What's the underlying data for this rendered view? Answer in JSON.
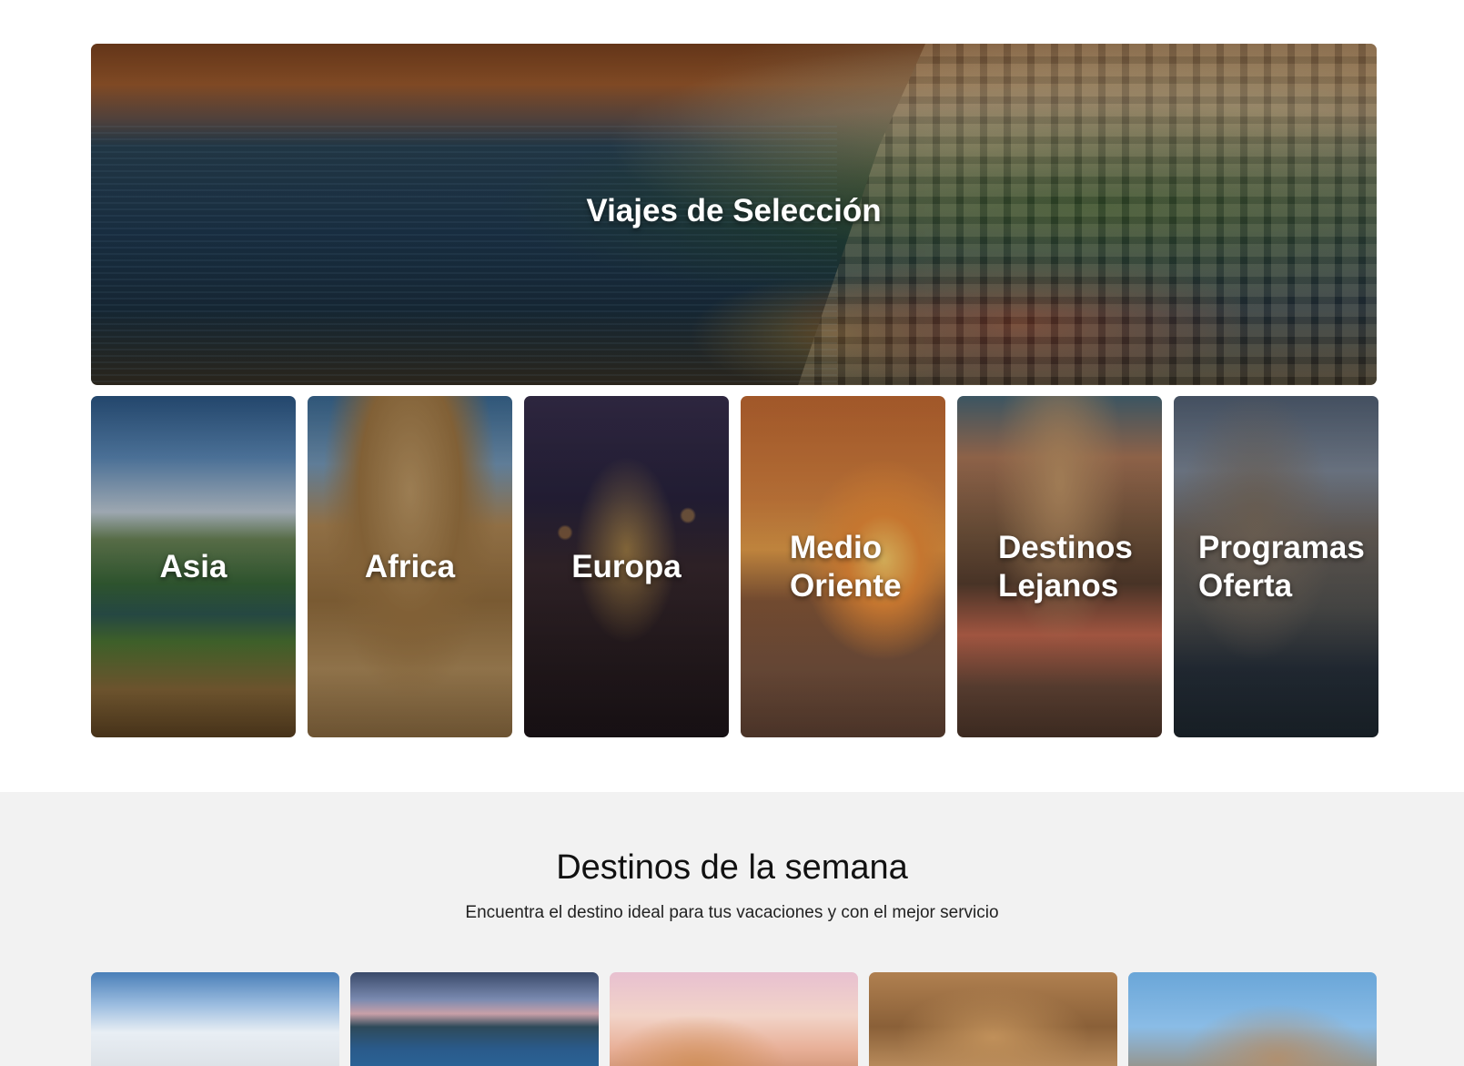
{
  "hero": {
    "title": "Viajes de Selección"
  },
  "categories": [
    {
      "label": "Asia"
    },
    {
      "label": "Africa"
    },
    {
      "label": "Europa"
    },
    {
      "label": "Medio\nOriente",
      "line1": "Medio",
      "line2": "Oriente"
    },
    {
      "label": "Destinos\nLejanos",
      "line1": "Destinos",
      "line2": "Lejanos"
    },
    {
      "label": "Programas\nOferta",
      "line1": "Programas",
      "line2": "Oferta"
    }
  ],
  "weekly": {
    "title": "Destinos de la semana",
    "subtitle": "Encuentra el destino ideal para tus vacaciones y con el mejor servicio",
    "cards": [
      {
        "image": "mountain-sky-photo"
      },
      {
        "image": "coast-sunset-photo"
      },
      {
        "image": "trulli-houses-photo"
      },
      {
        "image": "temple-columns-photo"
      },
      {
        "image": "cathedral-towers-photo"
      }
    ]
  }
}
